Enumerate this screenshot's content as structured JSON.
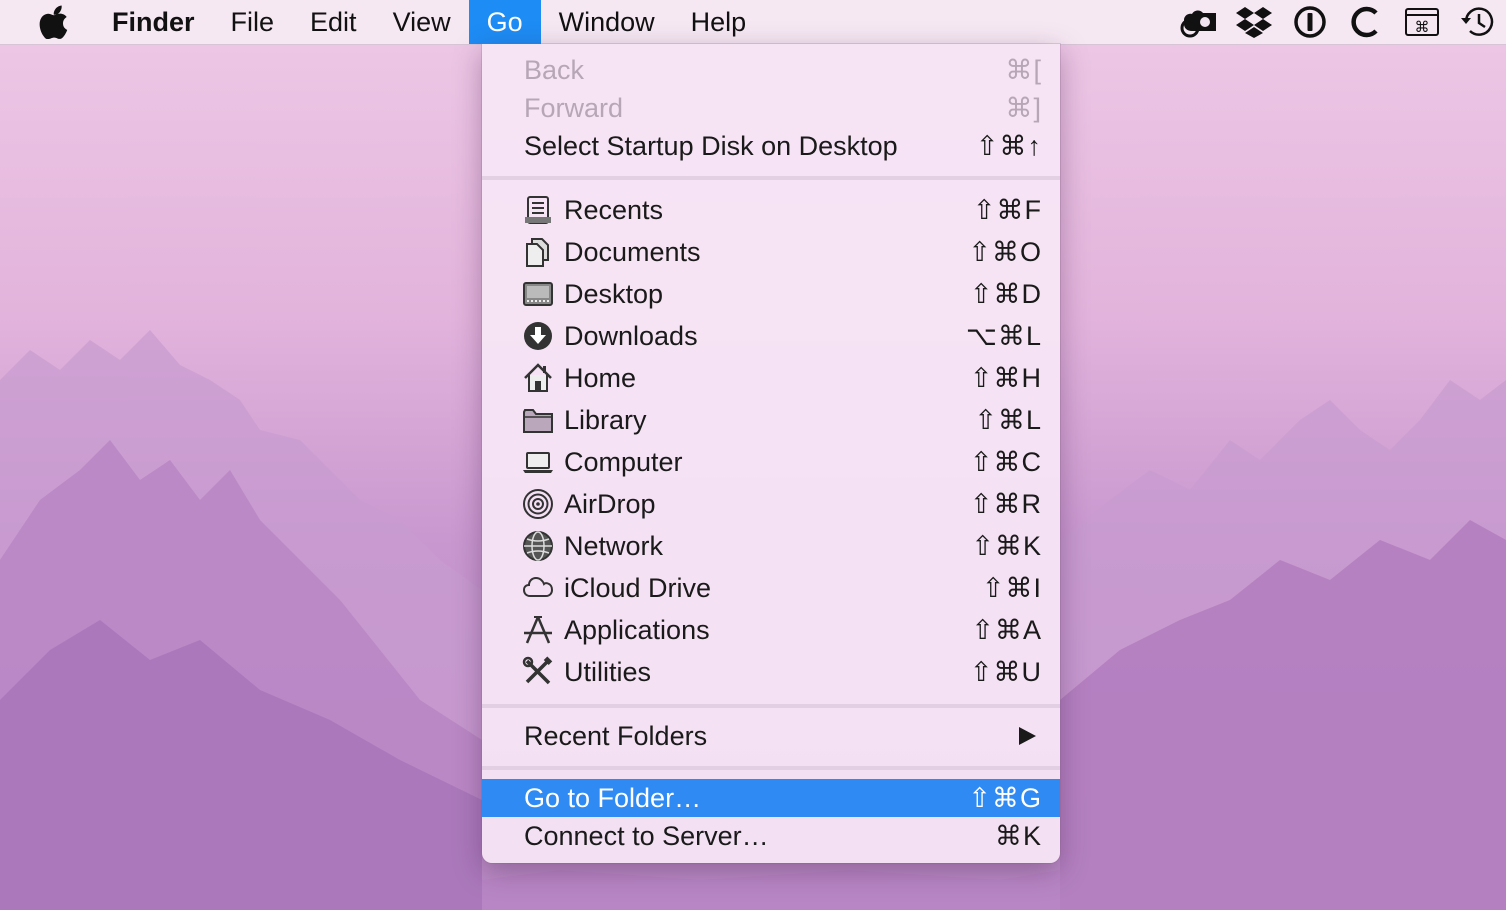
{
  "menubar": {
    "app_name": "Finder",
    "items": [
      "File",
      "Edit",
      "View",
      "Go",
      "Window",
      "Help"
    ],
    "active_item": "Go",
    "status_icons": [
      "cloud-app-icon",
      "dropbox-icon",
      "1password-icon",
      "c-app-icon",
      "command-key-icon",
      "time-machine-icon"
    ]
  },
  "go_menu": {
    "back": {
      "label": "Back",
      "shortcut": "⌘["
    },
    "forward": {
      "label": "Forward",
      "shortcut": "⌘]"
    },
    "startup": {
      "label": "Select Startup Disk on Desktop",
      "shortcut": "⇧⌘↑"
    },
    "places": [
      {
        "label": "Recents",
        "shortcut": "⇧⌘F",
        "icon": "recents-icon"
      },
      {
        "label": "Documents",
        "shortcut": "⇧⌘O",
        "icon": "documents-icon"
      },
      {
        "label": "Desktop",
        "shortcut": "⇧⌘D",
        "icon": "desktop-icon"
      },
      {
        "label": "Downloads",
        "shortcut": "⌥⌘L",
        "icon": "downloads-icon"
      },
      {
        "label": "Home",
        "shortcut": "⇧⌘H",
        "icon": "home-icon"
      },
      {
        "label": "Library",
        "shortcut": "⇧⌘L",
        "icon": "folder-icon"
      },
      {
        "label": "Computer",
        "shortcut": "⇧⌘C",
        "icon": "computer-icon"
      },
      {
        "label": "AirDrop",
        "shortcut": "⇧⌘R",
        "icon": "airdrop-icon"
      },
      {
        "label": "Network",
        "shortcut": "⇧⌘K",
        "icon": "network-icon"
      },
      {
        "label": "iCloud Drive",
        "shortcut": "⇧⌘I",
        "icon": "cloud-icon"
      },
      {
        "label": "Applications",
        "shortcut": "⇧⌘A",
        "icon": "applications-icon"
      },
      {
        "label": "Utilities",
        "shortcut": "⇧⌘U",
        "icon": "utilities-icon"
      }
    ],
    "recent_folders": {
      "label": "Recent Folders"
    },
    "go_to_folder": {
      "label": "Go to Folder…",
      "shortcut": "⇧⌘G"
    },
    "connect_server": {
      "label": "Connect to Server…",
      "shortcut": "⌘K"
    }
  },
  "colors": {
    "highlight": "#2f8bf3",
    "menubar_active": "#1d8cf4"
  }
}
